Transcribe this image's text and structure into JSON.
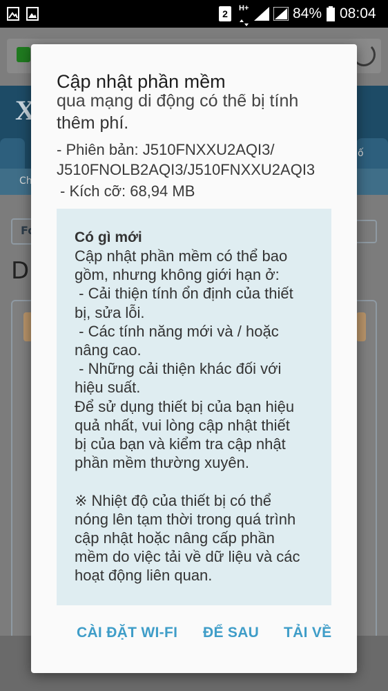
{
  "status_bar": {
    "sim_badge": "2",
    "network_type": "H+",
    "battery_percent": "84%",
    "time": "08:04"
  },
  "background": {
    "logo_text": "X",
    "tab_right_text": "ố",
    "subbar_text": "Ch",
    "button_text": "Fo",
    "heading_fragment": "Di"
  },
  "dialog": {
    "title": "Cập nhật phần mềm",
    "cut_off_line": "qua mạng di động có thể bị tính",
    "fee_line": "thêm phí.",
    "version_line": "- Phiên bản: J510FNXXU2AQI3/ J510FNOLB2AQI3/J510FNXXU2AQI3",
    "size_line": "- Kích cỡ: 68,94 MB",
    "whats_new_heading": "Có gì mới",
    "whats_new_body": "Cập nhật phần mềm có thể bao\ngồm, nhưng không giới hạn ở:\n - Cải thiện tính ổn định của thiết\nbị, sửa lỗi.\n - Các tính năng mới và / hoặc\nnâng cao.\n - Những cải thiện khác đối với\nhiệu suất.\nĐể sử dụng thiết bị của bạn hiệu\nquả nhất, vui lòng cập nhật thiết\nbị của bạn và kiểm tra cập nhật\nphần mềm thường xuyên.\n\n※ Nhiệt độ của thiết bị có thể\nnóng lên tạm thời trong quá trình\ncập nhật hoặc nâng cấp phần\nmềm do việc tải về dữ liệu và các\nhoạt động liên quan.",
    "buttons": {
      "wifi_settings": "CÀI ĐẶT WI-FI",
      "later": "ĐỂ SAU",
      "download": "TẢI VỀ"
    }
  },
  "colors": {
    "accent": "#3f9dc8",
    "info_box_bg": "#dfedf1"
  }
}
